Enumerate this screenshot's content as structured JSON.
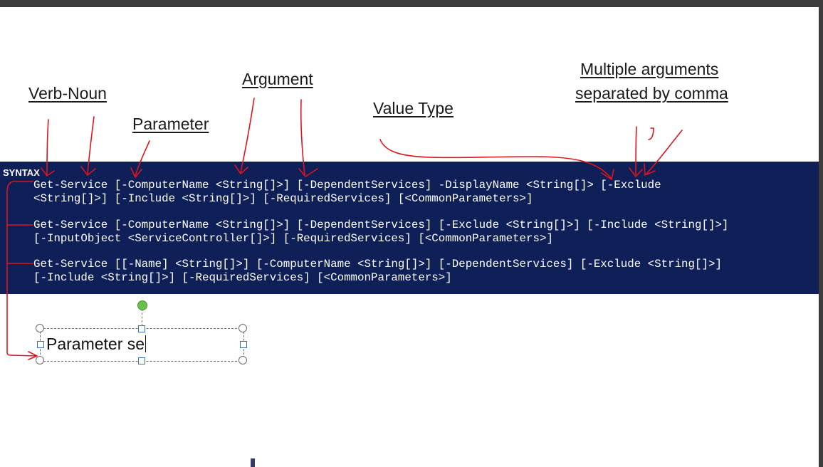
{
  "annotations": {
    "verb_noun": "Verb-Noun",
    "argument": "Argument",
    "parameter": "Parameter",
    "value_type": "Value Type",
    "multiple_line1": "Multiple arguments",
    "multiple_line2": "separated by comma"
  },
  "syntax": {
    "heading": "SYNTAX",
    "lines": [
      "Get-Service [-ComputerName <String[]>] [-DependentServices] -DisplayName <String[]> [-Exclude",
      "<String[]>] [-Include <String[]>] [-RequiredServices] [<CommonParameters>]",
      "Get-Service [-ComputerName <String[]>] [-DependentServices] [-Exclude <String[]>] [-Include <String[]>]",
      "[-InputObject <ServiceController[]>] [-RequiredServices] [<CommonParameters>]",
      "Get-Service [[-Name] <String[]>] [-ComputerName <String[]>] [-DependentServices] [-Exclude <String[]>]",
      "[-Include <String[]>] [-RequiredServices] [<CommonParameters>]"
    ]
  },
  "textbox": {
    "text": "Parameter se"
  },
  "colors": {
    "band": "#0f1f57",
    "pen": "#e0141e",
    "rotate_handle": "#6cc04a"
  }
}
